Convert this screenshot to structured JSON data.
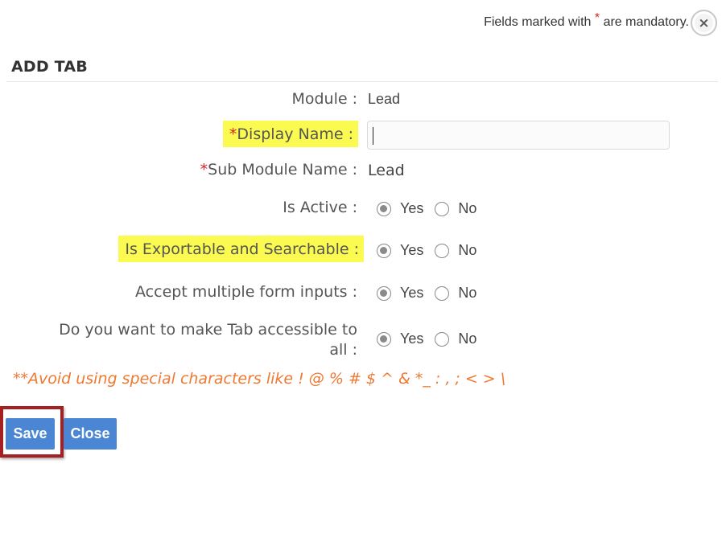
{
  "header": {
    "mandatory_prefix": "Fields marked with",
    "mandatory_star": "*",
    "mandatory_suffix": "are mandatory.",
    "close_glyph": "×"
  },
  "title": "ADD TAB",
  "form": {
    "module_label": "Module :",
    "module_value": "Lead",
    "display_name_required": "*",
    "display_name_label": "Display Name :",
    "display_name_value": "",
    "sub_module_required": "*",
    "sub_module_label": "Sub Module Name :",
    "sub_module_value": "Lead",
    "is_active_label": "Is Active :",
    "is_exportable_label": "Is Exportable and Searchable :",
    "accept_multiple_label": "Accept multiple form inputs :",
    "accessible_label_line1": "Do you want to make Tab accessible to",
    "accessible_label_line2": "all :",
    "yes_label": "Yes",
    "no_label": "No",
    "selections": {
      "is_active": "Yes",
      "is_exportable": "Yes",
      "accept_multiple": "Yes",
      "accessible_to_all": "Yes"
    }
  },
  "warning": "**Avoid using special characters like ! @ % # $ ^ & *_ : , ; < > \\",
  "buttons": {
    "save": "Save",
    "close": "Close"
  },
  "colors": {
    "highlight": "#fafa50",
    "required_star": "#e02020",
    "warning_text": "#f07830",
    "button_blue": "#4a86d4",
    "annotation_box": "#a52020"
  }
}
